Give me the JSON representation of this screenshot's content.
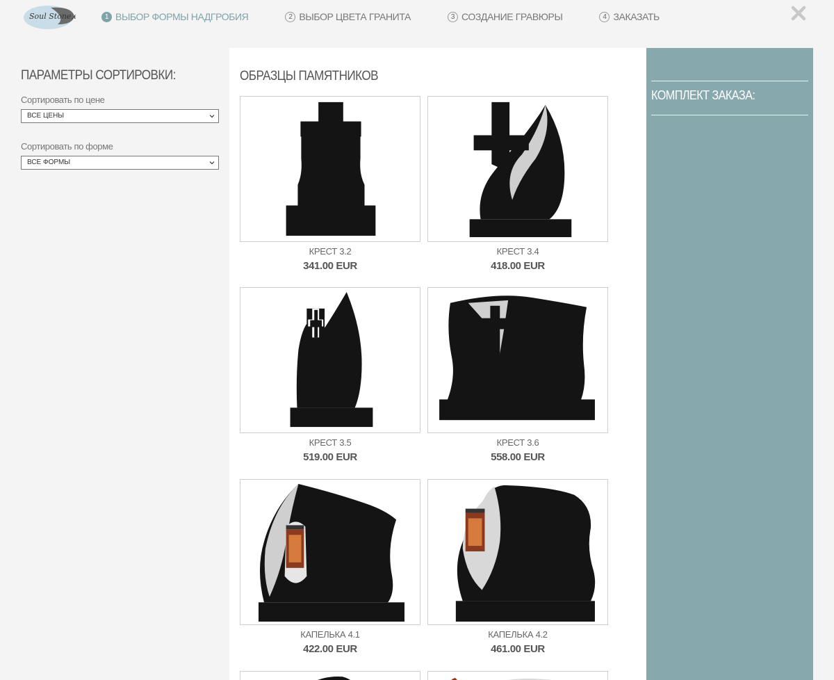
{
  "logo": {
    "text": "Soul Stone.eu"
  },
  "steps": [
    {
      "num": "1",
      "label": "ВЫБОР ФОРМЫ НАДГРОБИЯ"
    },
    {
      "num": "2",
      "label": "ВЫБОР ЦВЕТА ГРАНИТА"
    },
    {
      "num": "3",
      "label": "СОЗДАНИЕ ГРАВЮРЫ"
    },
    {
      "num": "4",
      "label": "ЗАКАЗАТЬ"
    }
  ],
  "sort": {
    "title": "ПАРАМЕТРЫ СОРТИРОВКИ:",
    "price_label": "Сортировать по цене",
    "price_value": "ВСЕ ЦЕНЫ",
    "shape_label": "Сортировать по форме",
    "shape_value": "ВСЕ ФОРМЫ"
  },
  "catalog": {
    "title": "ОБРАЗЦЫ ПАМЯТНИКОВ",
    "items": [
      {
        "name": "КРЕСТ 3.2",
        "price": "341.00 EUR"
      },
      {
        "name": "КРЕСТ 3.4",
        "price": "418.00 EUR"
      },
      {
        "name": "КРЕСТ 3.5",
        "price": "519.00 EUR"
      },
      {
        "name": "КРЕСТ 3.6",
        "price": "558.00 EUR"
      },
      {
        "name": "КАПЕЛЬКА 4.1",
        "price": "422.00 EUR"
      },
      {
        "name": "КАПЕЛЬКА 4.2",
        "price": "461.00 EUR"
      }
    ]
  },
  "order": {
    "title": "КОМПЛЕКТ ЗАКАЗА:"
  },
  "colors": {
    "accent": "#7fa3a8",
    "sidebar": "#87a8ad",
    "stone": "#141414"
  }
}
